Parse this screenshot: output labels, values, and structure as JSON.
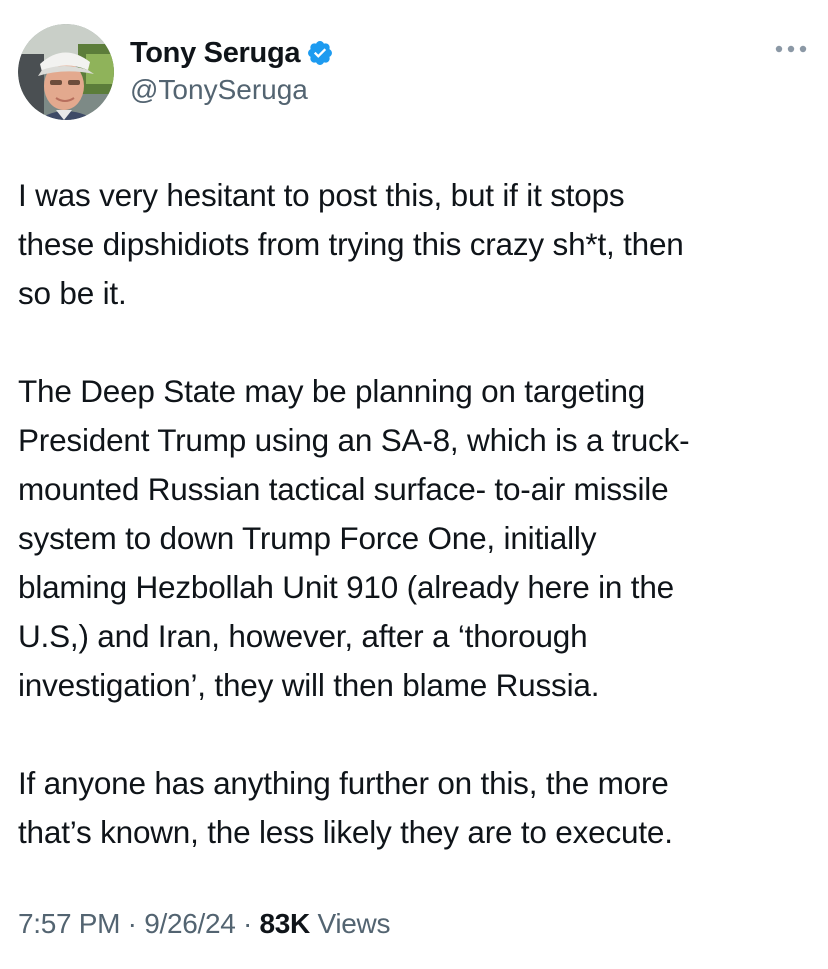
{
  "author": {
    "display_name": "Tony Seruga",
    "handle": "@TonySeruga",
    "verified": true,
    "verified_color": "#1d9bf0"
  },
  "menu": {
    "icon": "more-dots-icon"
  },
  "tweet": {
    "paragraphs": [
      "I was very hesitant to post this, but if it stops\nthese dipshidiots from trying this crazy sh*t, then\nso be it.",
      "The Deep State may be planning on targeting\nPresident Trump using an SA-8, which is a truck-\nmounted Russian tactical surface- to-air missile\nsystem to down Trump Force One, initially\nblaming Hezbollah Unit 910 (already here in the\nU.S,) and Iran, however, after a ‘thorough\ninvestigation’, they will then blame Russia.",
      "If anyone has anything further on this, the more\nthat’s known, the less likely they are to execute."
    ]
  },
  "meta": {
    "time": "7:57 PM",
    "separator": "·",
    "date": "9/26/24",
    "views_count": "83K",
    "views_label": "Views"
  },
  "colors": {
    "text": "#0f1419",
    "secondary": "#536471"
  }
}
